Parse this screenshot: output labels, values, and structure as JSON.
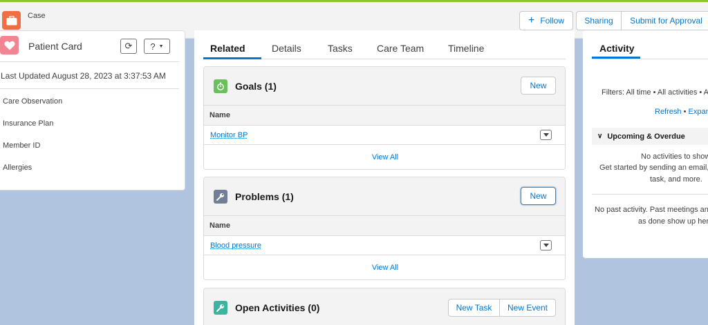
{
  "header": {
    "object_type": "Case",
    "follow_label": "Follow",
    "sharing_label": "Sharing",
    "submit_label": "Submit for Approval",
    "colors": {
      "accent_stripe": "#8ec334",
      "case_icon_bg": "#ef6e42"
    }
  },
  "patient_card": {
    "title": "Patient Card",
    "help_label": "?",
    "last_updated": "Last Updated August 28, 2023 at 3:37:53 AM",
    "fields": [
      "Care Observation",
      "Insurance Plan",
      "Member ID",
      "Allergies"
    ]
  },
  "tabs": [
    {
      "label": "Related",
      "active": true
    },
    {
      "label": "Details",
      "active": false
    },
    {
      "label": "Tasks",
      "active": false
    },
    {
      "label": "Care Team",
      "active": false
    },
    {
      "label": "Timeline",
      "active": false
    }
  ],
  "goals": {
    "title": "Goals (1)",
    "new_label": "New",
    "column": "Name",
    "rows": [
      "Monitor BP"
    ],
    "view_all": "View All",
    "icon": "stopwatch-icon"
  },
  "problems": {
    "title": "Problems (1)",
    "new_label": "New",
    "column": "Name",
    "rows": [
      "Blood pressure"
    ],
    "view_all": "View All",
    "icon": "wrench-icon"
  },
  "open_activities": {
    "title": "Open Activities (0)",
    "new_task_label": "New Task",
    "new_event_label": "New Event",
    "icon": "wrench-icon"
  },
  "activity": {
    "tab_label": "Activity",
    "filters": "Filters: All time • All activities • A",
    "refresh": "Refresh",
    "separator": "•",
    "expand": "Expan",
    "upcoming": "Upcoming & Overdue",
    "no_activities_1": "No activities to show",
    "no_activities_2": "Get started by sending an email,",
    "no_activities_3": "task, and more.",
    "no_past_1": "No past activity. Past meetings and",
    "no_past_2": "as done show up her"
  }
}
